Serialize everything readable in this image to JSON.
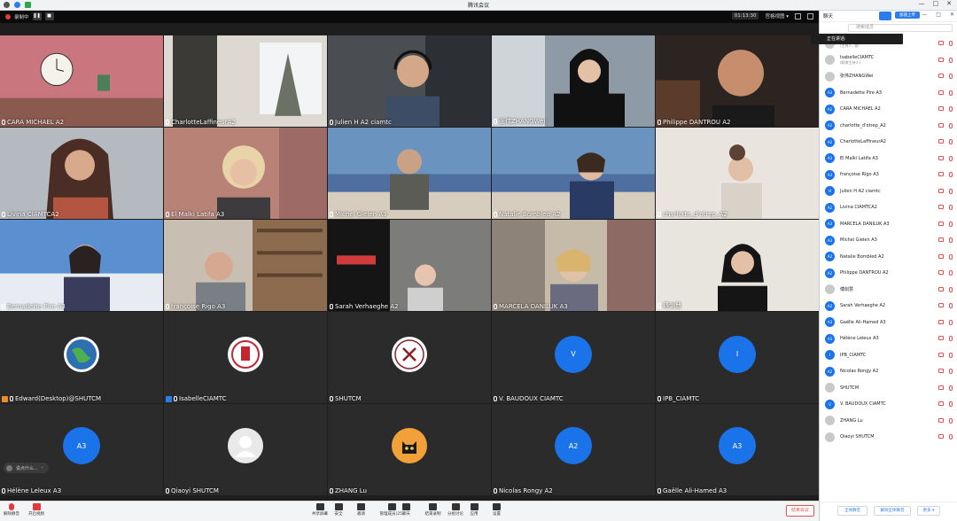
{
  "window": {
    "title": "腾讯会议",
    "minimize": "—",
    "maximize": "□",
    "close": "✕"
  },
  "topbar": {
    "recording_label": "录制中",
    "timer": "01:13:30",
    "layout_label": "宫格视图"
  },
  "tiles": [
    {
      "name": "CARA MICHAEL A2",
      "kind": "video",
      "scene": "room-clock"
    },
    {
      "name": "CharlotteLaffineurA2",
      "kind": "video",
      "scene": "room-window"
    },
    {
      "name": "Julien H A2 ciamtc",
      "kind": "video",
      "scene": "man-headset"
    },
    {
      "name": "张伟ZHANGWei",
      "kind": "video",
      "scene": "woman-office"
    },
    {
      "name": "Philippe DANTROU A2",
      "kind": "video",
      "scene": "man-dark"
    },
    {
      "name": "Livina CIAMTCA2",
      "kind": "video",
      "scene": "woman-glasses"
    },
    {
      "name": "El Malki Latifa A3",
      "kind": "video",
      "scene": "woman-blonde"
    },
    {
      "name": "Michel Gielen A3",
      "kind": "video",
      "scene": "man-sea"
    },
    {
      "name": "Natalie Bombled A2",
      "kind": "video",
      "scene": "woman-sea"
    },
    {
      "name": "charlotte_d'otrep_A2",
      "kind": "video",
      "scene": "woman-bun"
    },
    {
      "name": "Bernadette Pire A3",
      "kind": "video",
      "scene": "woman-sky"
    },
    {
      "name": "françoise Rigo A3",
      "kind": "video",
      "scene": "woman-shelves"
    },
    {
      "name": "Sarah Verhaeghe A2",
      "kind": "video",
      "scene": "child-room"
    },
    {
      "name": "MARCELA DANILUK A3",
      "kind": "video",
      "scene": "woman-clothes"
    },
    {
      "name": "傅剑慧",
      "kind": "video",
      "scene": "woman-glasses-asian"
    },
    {
      "name": "Edward(Desktop)@SHUTCM",
      "kind": "image",
      "image": "globe",
      "badge": "orange"
    },
    {
      "name": "IsabelleCIAMTC",
      "kind": "image",
      "image": "ciamtc-logo",
      "badge": "blue"
    },
    {
      "name": "SHUTCM",
      "kind": "image",
      "image": "shutcm-logo"
    },
    {
      "name": "V. BAUDOUX CIAMTC",
      "kind": "avatar",
      "initials": "V"
    },
    {
      "name": "IPB_CIAMTC",
      "kind": "avatar",
      "initials": "I"
    },
    {
      "name": "Hélène Leleux A3",
      "kind": "avatar",
      "initials": "A3"
    },
    {
      "name": "Qiaoyi SHUTCM",
      "kind": "image",
      "image": "default-user"
    },
    {
      "name": "ZHANG Lu",
      "kind": "image",
      "image": "cat"
    },
    {
      "name": "Nicolas Rongy A2",
      "kind": "avatar",
      "initials": "A2"
    },
    {
      "name": "Gaëlle Ali-Hamed A3",
      "kind": "avatar",
      "initials": "A3"
    }
  ],
  "chat_bubble": {
    "text": "说点什么..."
  },
  "toolbar": {
    "unmute": "解除静音",
    "start_video": "开启视频",
    "items": [
      "共享屏幕",
      "安全",
      "邀请",
      "管理成员(25)",
      "聊天",
      "结束录制",
      "分组讨论",
      "应用",
      "设置"
    ],
    "end_meeting": "结束会议"
  },
  "panel": {
    "tab": "聊天",
    "upload_label": "加速上传",
    "search_placeholder": "搜索成员",
    "speaking_label": "正在讲话:",
    "participants": [
      {
        "name": "Edward(Desktop)@SHUTCM",
        "sub": "(主持人, 我)",
        "av": "img"
      },
      {
        "name": "IsabelleCIAMTC",
        "sub": "(联席主持人)",
        "av": "img"
      },
      {
        "name": "张伟ZHANGWei",
        "sub": "",
        "av": "img"
      },
      {
        "name": "Bernadette Pire A3",
        "sub": "",
        "av": "A3"
      },
      {
        "name": "CARA MICHAEL A2",
        "sub": "",
        "av": "A2"
      },
      {
        "name": "charlotte_d'otrep_A2",
        "sub": "",
        "av": "A2"
      },
      {
        "name": "CharlotteLaffineurA2",
        "sub": "",
        "av": "A2"
      },
      {
        "name": "El Malki Latifa A3",
        "sub": "",
        "av": "A3"
      },
      {
        "name": "françoise Rigo A3",
        "sub": "",
        "av": "A3"
      },
      {
        "name": "Julien H A2 ciamtc",
        "sub": "",
        "av": "H"
      },
      {
        "name": "Livina CIAMTCA2",
        "sub": "",
        "av": "A2"
      },
      {
        "name": "MARCELA DANILUK A3",
        "sub": "",
        "av": "A3"
      },
      {
        "name": "Michel Gielen A3",
        "sub": "",
        "av": "A3"
      },
      {
        "name": "Natalie Bombled A2",
        "sub": "",
        "av": "A2"
      },
      {
        "name": "Philippe DANTROU A2",
        "sub": "",
        "av": "A2"
      },
      {
        "name": "傅剑慧",
        "sub": "",
        "av": "img"
      },
      {
        "name": "Sarah Verhaeghe A2",
        "sub": "",
        "av": "A2"
      },
      {
        "name": "Gaëlle Ali-Hamed A3",
        "sub": "",
        "av": "A3"
      },
      {
        "name": "Hélène Leleux A3",
        "sub": "",
        "av": "A3"
      },
      {
        "name": "IPB_CIAMTC",
        "sub": "",
        "av": "I"
      },
      {
        "name": "Nicolas Rongy A2",
        "sub": "",
        "av": "A2"
      },
      {
        "name": "SHUTCM",
        "sub": "",
        "av": "img"
      },
      {
        "name": "V. BAUDOUX CIAMTC",
        "sub": "",
        "av": "V"
      },
      {
        "name": "ZHANG Lu",
        "sub": "",
        "av": "img"
      },
      {
        "name": "Qiaoyi SHUTCM",
        "sub": "",
        "av": "img"
      }
    ],
    "footer": {
      "mute_all": "全体静音",
      "unmute_all": "解除全体静音",
      "more": "更多 ▾"
    }
  },
  "colors": {
    "accent": "#1a73e8",
    "danger": "#e45151",
    "recording": "#e23a3a"
  }
}
